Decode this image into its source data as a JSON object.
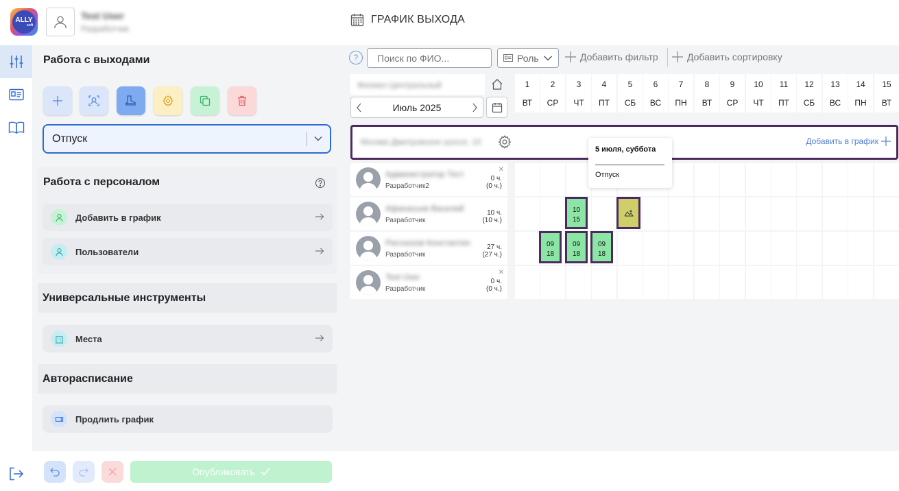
{
  "header": {
    "logo_text": "ALLY",
    "logo_sub": "soft",
    "user_name": "Test User",
    "user_role": "Разработчик",
    "page_title": "ГРАФИК ВЫХОДА"
  },
  "left_panel": {
    "work_title": "Работа с выходами",
    "selected_mode": "Отпуск",
    "staff_title": "Работа с персоналом",
    "staff_items": [
      {
        "label": "Добавить в график"
      },
      {
        "label": "Пользователи"
      }
    ],
    "tools_title": "Универсальные инструменты",
    "tools_items": [
      {
        "label": "Места"
      }
    ],
    "auto_title": "Автораспиcание",
    "auto_items": [
      {
        "label": "Продлить график"
      }
    ],
    "publish_label": "Опубликовать"
  },
  "toolbar": {
    "help": "?",
    "search_placeholder": "Поиск по ФИО...",
    "role_label": "Роль",
    "add_filter": "Добавить фильтр",
    "add_sort": "Добавить сортировку"
  },
  "controls": {
    "location_text": "Филиал Центральный",
    "month": "Июль 2025"
  },
  "days": [
    {
      "n": "1",
      "w": "ВТ"
    },
    {
      "n": "2",
      "w": "СР"
    },
    {
      "n": "3",
      "w": "ЧТ"
    },
    {
      "n": "4",
      "w": "ПТ"
    },
    {
      "n": "5",
      "w": "СБ"
    },
    {
      "n": "6",
      "w": "ВС"
    },
    {
      "n": "7",
      "w": "ПН"
    },
    {
      "n": "8",
      "w": "ВТ"
    },
    {
      "n": "9",
      "w": "СР"
    },
    {
      "n": "10",
      "w": "ЧТ"
    },
    {
      "n": "11",
      "w": "ПТ"
    },
    {
      "n": "12",
      "w": "СБ"
    },
    {
      "n": "13",
      "w": "ВС"
    },
    {
      "n": "14",
      "w": "ПН"
    },
    {
      "n": "15",
      "w": "ВТ"
    }
  ],
  "group": {
    "name": "Москва Дмитровское шоссе, 10",
    "add_label": "Добавить в график"
  },
  "employees": [
    {
      "name": "Администратор Тест",
      "role": "Разработчик2",
      "hours": "0 ч.",
      "hours2": "(0 ч.)",
      "removable": true
    },
    {
      "name": "Афанасьев Василий",
      "role": "Разработчик",
      "hours": "10 ч.",
      "hours2": "(10 ч.)",
      "removable": false
    },
    {
      "name": "Рассказов Константин",
      "role": "Разработчик",
      "hours": "27 ч.",
      "hours2": "(27 ч.)",
      "removable": false
    },
    {
      "name": "Test User",
      "role": "Разработчик",
      "hours": "0 ч.",
      "hours2": "(0 ч.)",
      "removable": true
    }
  ],
  "shifts": [
    {
      "emp": 1,
      "day": 3,
      "start": "10",
      "end": "15"
    },
    {
      "emp": 2,
      "day": 2,
      "start": "09",
      "end": "18"
    },
    {
      "emp": 2,
      "day": 3,
      "start": "09",
      "end": "18"
    },
    {
      "emp": 2,
      "day": 4,
      "start": "09",
      "end": "18"
    }
  ],
  "vacations": [
    {
      "emp": 1,
      "day": 5
    }
  ],
  "tooltip": {
    "title": "5 июля, суббота",
    "value": "Отпуск"
  },
  "colors": {
    "accent": "#2e6ad1",
    "shift_fill": "#8be6a6",
    "vacation_fill": "#cfcf6a",
    "selection_border": "#4b2a5e"
  }
}
